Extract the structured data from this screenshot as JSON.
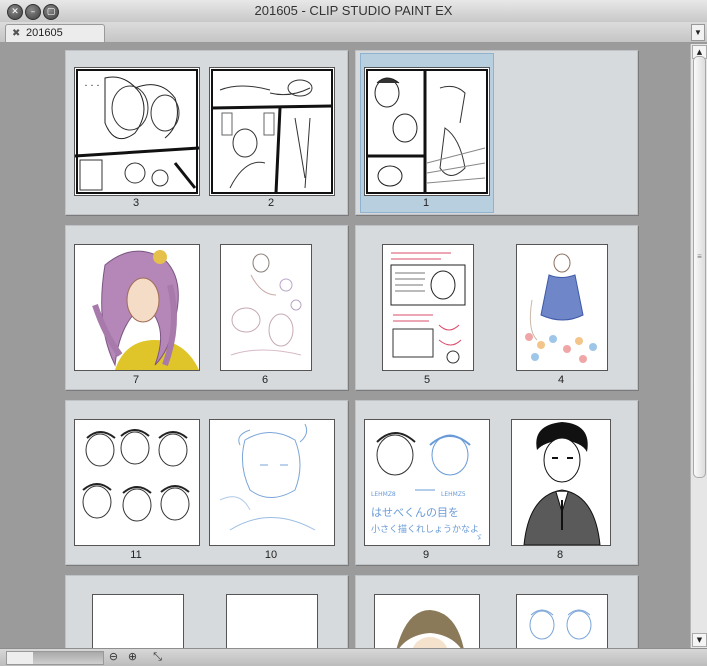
{
  "window": {
    "title": "201605 - CLIP STUDIO PAINT EX",
    "close_glyph": "✕",
    "minimize_glyph": "–",
    "zoom_glyph": "▢"
  },
  "tabbar": {
    "tab_label": "201605",
    "tab_close_glyph": "✖",
    "dropdown_glyph": "▼"
  },
  "pages": [
    {
      "number": "3",
      "label": "3"
    },
    {
      "number": "2",
      "label": "2"
    },
    {
      "number": "1",
      "label": "1",
      "selected": true
    },
    {
      "number": "7",
      "label": "7"
    },
    {
      "number": "6",
      "label": "6"
    },
    {
      "number": "5",
      "label": "5"
    },
    {
      "number": "4",
      "label": "4"
    },
    {
      "number": "11",
      "label": "11"
    },
    {
      "number": "10",
      "label": "10"
    },
    {
      "number": "9",
      "label": "9"
    },
    {
      "number": "8",
      "label": "8"
    }
  ],
  "page_texts": {
    "p9_annot1": "LEHMZ8",
    "p9_annot2": "LEHMZ5",
    "p9_line1": "はせべくんの目を",
    "p9_line2": "小さく描くれしょうかなよ",
    "p9_mark": "ゞ"
  },
  "scrollbar": {
    "up_glyph": "▲",
    "down_glyph": "▼",
    "grip_glyph": "≡"
  },
  "statusbar": {
    "zoom_out_glyph": "⊖",
    "zoom_in_glyph": "⊕",
    "fit_glyph": "⤡"
  }
}
